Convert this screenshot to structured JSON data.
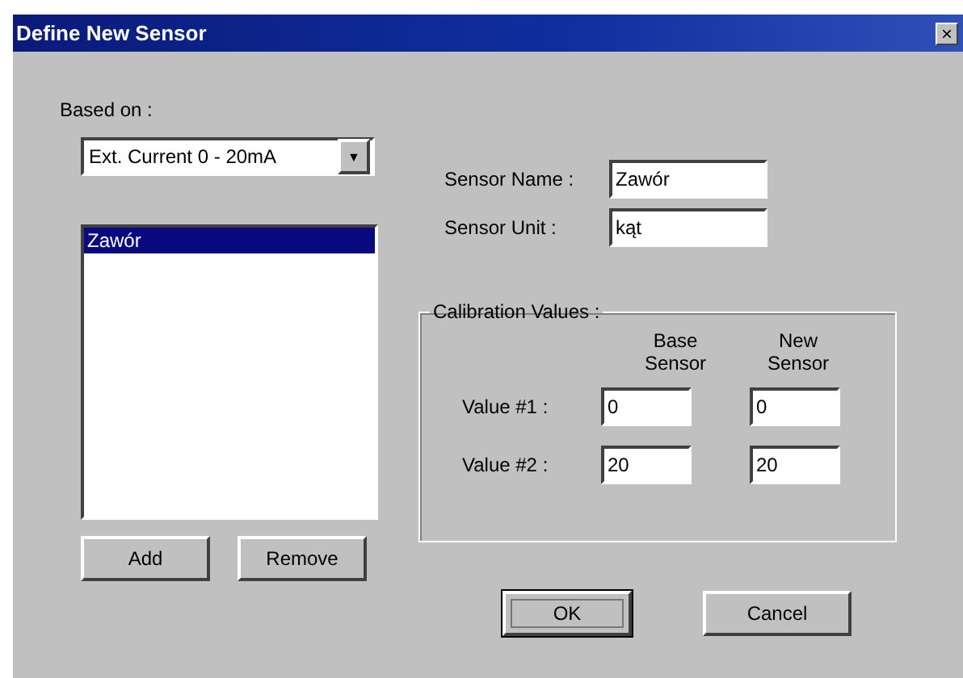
{
  "window": {
    "title": "Define New Sensor",
    "close": "×"
  },
  "based_on": {
    "label": "Based on :",
    "value": "Ext. Current 0 - 20mA",
    "arrow": "▼"
  },
  "sensors": [
    {
      "name": "Zawór",
      "selected": true
    }
  ],
  "list_buttons": [
    "Add",
    "Remove"
  ],
  "fields": [
    {
      "label": "Sensor Name :",
      "value": "Zawór"
    },
    {
      "label": "Sensor Unit :",
      "value": "kąt"
    }
  ],
  "calibration": {
    "title": "Calibration Values :",
    "columns": [
      "Base\nSensor",
      "New\nSensor"
    ],
    "rows": [
      {
        "label": "Value #1 :",
        "values": [
          "0",
          "0"
        ]
      },
      {
        "label": "Value #2 :",
        "values": [
          "20",
          "20"
        ]
      }
    ]
  },
  "buttons": [
    {
      "label": "OK",
      "default": true
    },
    {
      "label": "Cancel",
      "default": false
    }
  ]
}
